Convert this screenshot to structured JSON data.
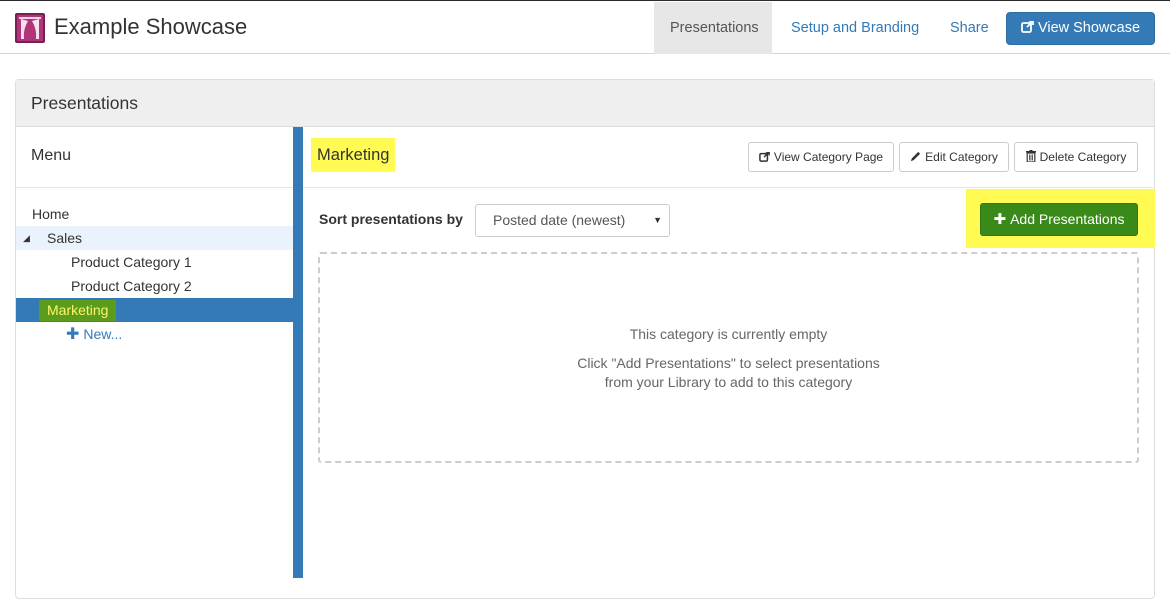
{
  "app": {
    "title": "Example Showcase",
    "nav": [
      {
        "label": "Presentations",
        "active": true
      },
      {
        "label": "Setup and Branding",
        "active": false
      },
      {
        "label": "Share",
        "active": false
      }
    ],
    "view_showcase_label": "View Showcase"
  },
  "panel": {
    "title": "Presentations"
  },
  "sidebar": {
    "menu_label": "Menu",
    "items": [
      {
        "label": "Home",
        "level": 0
      },
      {
        "label": "Sales",
        "level": 0,
        "expanded": true
      },
      {
        "label": "Product Category 1",
        "level": 1
      },
      {
        "label": "Product Category 2",
        "level": 1
      },
      {
        "label": "Marketing",
        "level": 0,
        "selected": true
      },
      {
        "label": "New...",
        "level": 1
      }
    ]
  },
  "category": {
    "title": "Marketing",
    "view_page_label": "View Category Page",
    "edit_label": "Edit Category",
    "delete_label": "Delete Category",
    "sort_label": "Sort presentations by",
    "sort_value": "Posted date (newest)",
    "add_label": "Add Presentations",
    "empty_title": "This category is currently empty",
    "empty_line1": "Click \"Add Presentations\" to select presentations",
    "empty_line2": "from your Library to add to this category"
  },
  "colors": {
    "primary": "#337ab7",
    "success": "#3a8a19",
    "highlight": "#fffb52",
    "logo": "#b0357a"
  },
  "icons": {
    "logo": "theater-curtain-icon",
    "view_showcase": "external-link-icon",
    "view_page": "external-link-icon",
    "edit": "pencil-icon",
    "delete": "trash-icon",
    "add": "plus-icon",
    "expand": "triangle-down-icon"
  }
}
